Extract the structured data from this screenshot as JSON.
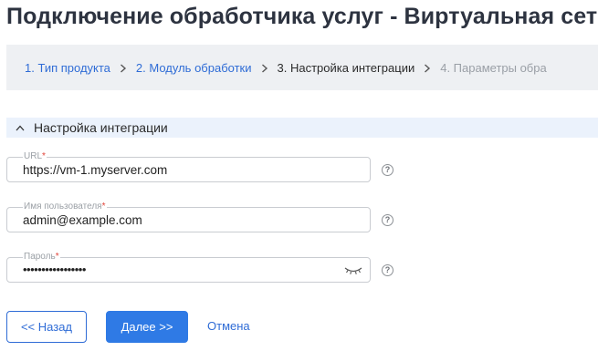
{
  "page": {
    "title": "Подключение обработчика услуг - Виртуальная сеть,"
  },
  "stepper": {
    "steps": [
      {
        "label": "1. Тип продукта",
        "state": "done"
      },
      {
        "label": "2. Модуль обработки",
        "state": "done"
      },
      {
        "label": "3. Настройка интеграции",
        "state": "current"
      },
      {
        "label": "4. Параметры обра",
        "state": "future"
      }
    ]
  },
  "section": {
    "title": "Настройка интеграции",
    "icon": "chevron-up-icon"
  },
  "form": {
    "url": {
      "label": "URL",
      "required_mark": "*",
      "value": "https://vm-1.myserver.com",
      "help": "?"
    },
    "username": {
      "label": "Имя пользователя",
      "required_mark": "*",
      "value": "admin@example.com",
      "help": "?"
    },
    "password": {
      "label": "Пароль",
      "required_mark": "*",
      "value": "•••••••••••••••••",
      "help": "?",
      "toggle_icon": "eye-closed-icon"
    }
  },
  "actions": {
    "back_label": "<< Назад",
    "next_label": "Далее >>",
    "cancel_label": "Отмена"
  },
  "colors": {
    "accent": "#2f6cd6",
    "primary_button": "#2f7ae5",
    "required": "#e0443a",
    "section_bg": "#ebf2fc",
    "stepper_bg": "#eef0f3"
  }
}
